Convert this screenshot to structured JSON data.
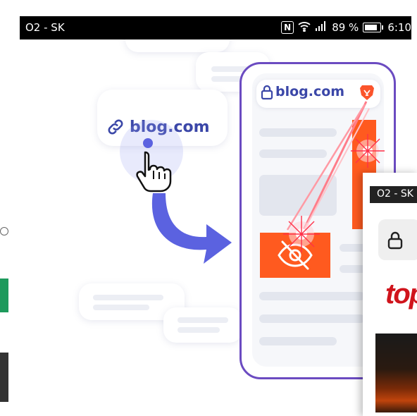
{
  "status_bar": {
    "carrier": "O2 - SK",
    "battery": "89 %",
    "time": "6:10"
  },
  "illustration": {
    "link_label": "blog.com",
    "phone_url": "blog.com",
    "icons": [
      "link-icon",
      "hand-pointer-icon",
      "lock-icon",
      "brave-lion-icon",
      "crossed-eye-icon",
      "curved-arrow-icon"
    ]
  },
  "overlay_window": {
    "carrier": "O2 - SK",
    "brand_text": "top"
  },
  "colors": {
    "brand_blue": "#3b47a8",
    "phone_border": "#6b4bc1",
    "tracker_orange": "#ff5a1f",
    "arrow_blue": "#5b62e0"
  }
}
